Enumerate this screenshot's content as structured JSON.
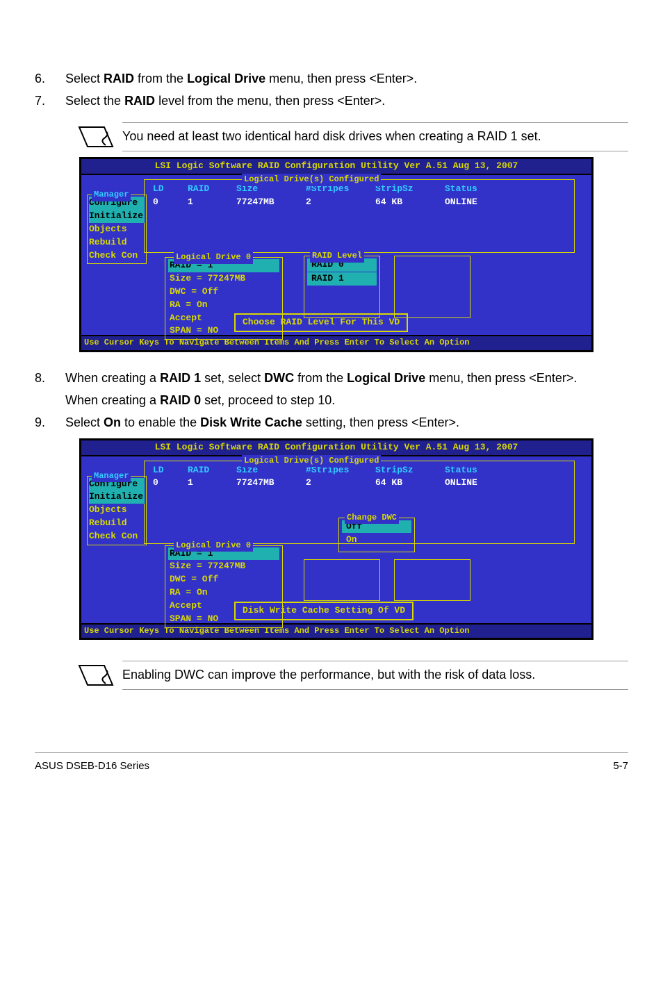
{
  "step6": {
    "num": "6.",
    "pre": "Select ",
    "b1": "RAID",
    "mid1": " from the ",
    "b2": "Logical Drive",
    "post": " menu, then press <Enter>."
  },
  "step7": {
    "num": "7.",
    "pre": "Select the ",
    "b1": "RAID",
    "post": " level from the menu, then press <Enter>."
  },
  "note1": "You need at least two identical hard disk drives when creating a RAID 1 set.",
  "bios": {
    "title": "LSI Logic Software RAID Configuration Utility Ver A.51 Aug 13, 2007",
    "panel_label": "Logical Drive(s) Configured",
    "headers": {
      "ld": "LD",
      "raid": "RAID",
      "size": "Size",
      "stripes": "#Stripes",
      "stripsz": "StripSz",
      "status": "Status"
    },
    "row": {
      "ld": "0",
      "raid": "1",
      "size": "77247MB",
      "stripes": "2",
      "stripsz": "64 KB",
      "status": "ONLINE"
    },
    "side_label": "Manager",
    "side": [
      "Configure",
      "Initialize",
      "Objects",
      "Rebuild",
      "Check Con"
    ],
    "ld0_label": "Logical Drive 0",
    "ld0": {
      "raid": "RAID = 1",
      "size": "Size = 77247MB",
      "dwc": "DWC  = Off",
      "ra": "RA   = On",
      "accept": "Accept",
      "span": "SPAN = NO"
    },
    "raid_label": "RAID Level",
    "raid_opts": [
      "RAID 0",
      "RAID 1"
    ],
    "msg": "Choose RAID Level For This VD",
    "footer": "Use Cursor Keys To Navigate Between Items And Press Enter To Select An Option"
  },
  "step8": {
    "num": "8.",
    "pre": "When creating a ",
    "b1": "RAID 1",
    "mid1": " set, select ",
    "b2": "DWC",
    "mid2": " from the ",
    "b3": "Logical Drive",
    "post": " menu, then press <Enter>.",
    "line2pre": "When creating a ",
    "l2b1": "RAID 0",
    "l2post": " set, proceed to step 10."
  },
  "step9": {
    "num": "9.",
    "pre": "Select ",
    "b1": "On",
    "mid1": " to enable the ",
    "b2": "Disk Write Cache",
    "post": " setting, then press <Enter>."
  },
  "bios2": {
    "dwc_label": "Change DWC",
    "dwc_opts": [
      "Off",
      "On"
    ],
    "msg": "Disk Write Cache Setting Of VD"
  },
  "note2": "Enabling DWC can improve the performance, but with the risk of data loss.",
  "footer_left": "ASUS DSEB-D16 Series",
  "footer_right": "5-7"
}
